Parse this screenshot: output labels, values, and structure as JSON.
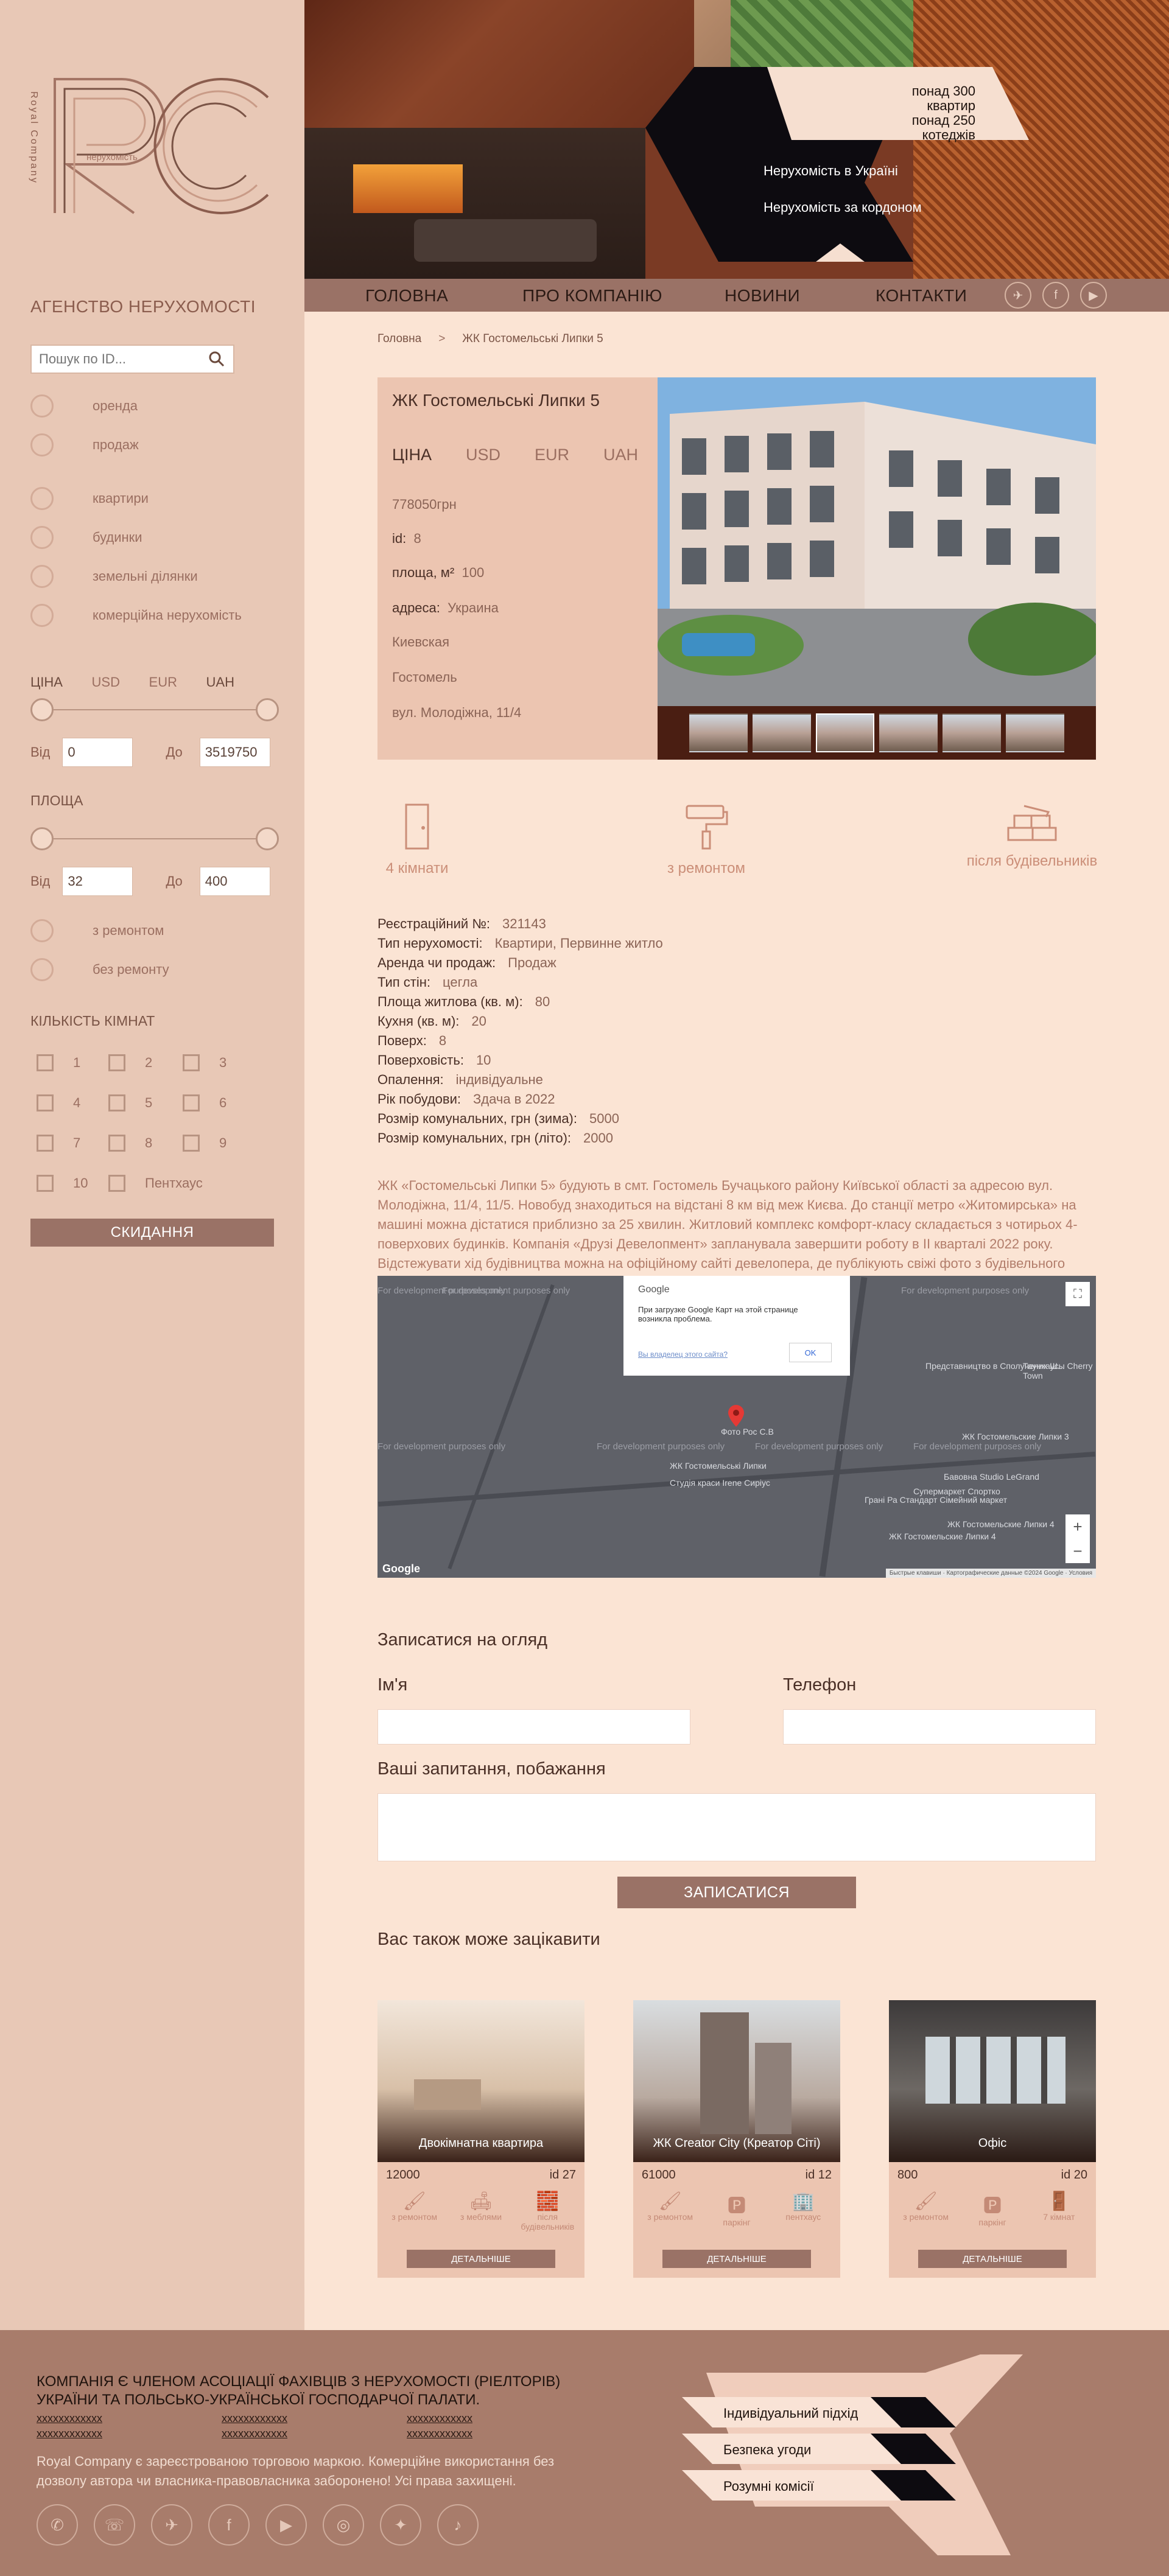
{
  "brand": {
    "logo_letters": "RC",
    "logo_side": "Royal Company",
    "logo_small": "нерухомість",
    "agency_title": "АГЕНСТВО НЕРУХОМОСТІ"
  },
  "search": {
    "placeholder": "Пошук по ID..."
  },
  "filters": {
    "deal_types": [
      "оренда",
      "продаж"
    ],
    "property_types": [
      "квартири",
      "будинки",
      "земельні ділянки",
      "комерційна нерухомість"
    ],
    "price_label": "ЦІНА",
    "currencies": [
      "ЦІНА",
      "USD",
      "EUR",
      "UAH"
    ],
    "price_from_label": "Від",
    "price_from": "0",
    "price_to_label": "До",
    "price_to": "3519750",
    "area_label": "ПЛОЩА",
    "area_from": "32",
    "area_to": "400",
    "condition": [
      "з ремонтом",
      "без ремонту"
    ],
    "rooms_label": "КІЛЬКІСТЬ КІМНАТ",
    "rooms": [
      "1",
      "2",
      "3",
      "4",
      "5",
      "6",
      "7",
      "8",
      "9",
      "10",
      "Пентхаус"
    ],
    "reset": "СКИДАННЯ"
  },
  "hero": {
    "stat1": "понад 300 квартир",
    "stat2": "понад 250 котеджів",
    "link1": "Нерухомість в Україні",
    "link2": "Нерухомість за кордоном"
  },
  "nav": {
    "items": [
      "ГОЛОВНА",
      "ПРО КОМПАНІЮ",
      "НОВИНИ",
      "КОНТАКТИ"
    ],
    "social_icons": [
      "telegram-icon",
      "facebook-icon",
      "youtube-icon"
    ]
  },
  "breadcrumb": {
    "home": "Головна",
    "sep": ">",
    "current": "ЖК Гостомельські Липки 5"
  },
  "property": {
    "title": "ЖК Гостомельські Липки 5",
    "currency_tabs": [
      "ЦІНА",
      "USD",
      "EUR",
      "UAH"
    ],
    "price": "778050грн",
    "id_label": "id:",
    "id": "8",
    "area_label": "площа, м²",
    "area": "100",
    "address_label": "адреса:",
    "country": "Украина",
    "region": "Киевская",
    "city": "Гостомель",
    "street": "вул. Молодіжна, 11/4"
  },
  "features": [
    {
      "label": "4 кімнати",
      "icon": "door-icon"
    },
    {
      "label": "з ремонтом",
      "icon": "paint-roller-icon"
    },
    {
      "label": "після будівельників",
      "icon": "bricks-icon"
    }
  ],
  "details": [
    {
      "k": "Реєстраційний №:",
      "v": "321143"
    },
    {
      "k": "Тип нерухомості:",
      "v": "Квартири, Первинне житло"
    },
    {
      "k": "Аренда чи продаж:",
      "v": "Продаж"
    },
    {
      "k": "Тип стін:",
      "v": "цегла"
    },
    {
      "k": "Площа житлова (кв. м):",
      "v": "80"
    },
    {
      "k": "Кухня (кв. м):",
      "v": "20"
    },
    {
      "k": "Поверх:",
      "v": "8"
    },
    {
      "k": "Поверховість:",
      "v": "10"
    },
    {
      "k": "Опалення:",
      "v": "індивідуальне"
    },
    {
      "k": "Рік побудови:",
      "v": "Здача в 2022"
    },
    {
      "k": "Розмір комунальних, грн (зима):",
      "v": "5000"
    },
    {
      "k": "Розмір комунальних, грн (літо):",
      "v": "2000"
    }
  ],
  "description": "ЖК «Гостомельські Липки 5» будують в смт. Гостомель Бучацького району Київської області за адресою вул. Молодіжна, 11/4, 11/5. Новобуд знаходиться на відстані 8 км від меж Києва. До станції метро «Житомирська» на машині можна дістатися приблизно за 25 хвилин. Житловий комплекс комфорт-класу складається з чотирьох 4-поверхових будинків. Компанія «Друзі Девелопмент» запланувала завершити роботу в II кварталі 2022 року. Відстежувати хід будівництва можна на офіційному сайті девелопера, де публікують свіжі фото з будівельного майданчика.",
  "map": {
    "dialog_brand": "Google",
    "dialog_text": "При загрузке Google Карт на этой странице возникла проблема.",
    "dialog_link": "Вы владелец этого сайта?",
    "dialog_ok": "OK",
    "watermark": "For development purposes only",
    "places": [
      "Представництво в Сполучених Ш...",
      "Таунхаусы Cherry Town",
      "ЖК Гостомельские Липки 3",
      "Бавовна Studio LeGrand",
      "Супермаркет Спортко",
      "ЖК Гостомельские Липки 4",
      "ЖК Гостомельські Липки",
      "Студія краси Irene Сиріус",
      "Грані Ра Стандарт Сімейний маркет",
      "ЖК Гостомельские Липки 4",
      "Фото Рос С.В"
    ],
    "footer_note": "Быстрые клавиши · Картографические данные ©2024 Google · Условия",
    "zoom_in": "+",
    "zoom_out": "−"
  },
  "form": {
    "title": "Записатися на огляд",
    "name_label": "Ім'я",
    "phone_label": "Телефон",
    "message_label": "Ваші запитання, побажання",
    "submit": "ЗАПИСАТИСЯ"
  },
  "related": {
    "title": "Вас також може зацікавити",
    "cards": [
      {
        "title": "Двокімнатна квартира",
        "price": "12000",
        "id": "id 27",
        "tags": [
          "з ремонтом",
          "з меблями",
          "після будівельників"
        ],
        "button": "ДЕТАЛЬНІШЕ"
      },
      {
        "title": "ЖК Creator City (Креатор Сіті)",
        "price": "61000",
        "id": "id 12",
        "tags": [
          "з ремонтом",
          "паркінг",
          "пентхаус"
        ],
        "button": "ДЕТАЛЬНІШЕ"
      },
      {
        "title": "Офіс",
        "price": "800",
        "id": "id 20",
        "tags": [
          "з ремонтом",
          "паркінг",
          "7 кімнат"
        ],
        "button": "ДЕТАЛЬНІШЕ"
      }
    ]
  },
  "footer": {
    "member_text": "КОМПАНІЯ Є ЧЛЕНОМ АСОЦІАЦІЇ ФАХІВЦІВ З НЕРУХОМОСТІ (РІЕЛТОРІВ) УКРАЇНИ ТА ПОЛЬСЬКО-УКРАЇНСЬКОЇ ГОСПОДАРЧОЇ ПАЛАТИ.",
    "links": [
      "xxxxxxxxxxxx",
      "xxxxxxxxxxxx",
      "xxxxxxxxxxxx",
      "xxxxxxxxxxxx",
      "xxxxxxxxxxxx",
      "xxxxxxxxxxxx"
    ],
    "copyright": "Royal Company є зареєстрованою торговою маркою. Комерційне використання без дозволу автора чи власника-правовласника заборонено! Усі права захищені.",
    "social_icons": [
      "viber-icon",
      "whatsapp-icon",
      "telegram-icon",
      "facebook-icon",
      "youtube-icon",
      "instagram-icon",
      "twitter-icon",
      "tiktok-icon"
    ],
    "taglines": [
      "Індивідуальний підхід",
      "Безпека угоди",
      "Розумні комісії"
    ]
  }
}
